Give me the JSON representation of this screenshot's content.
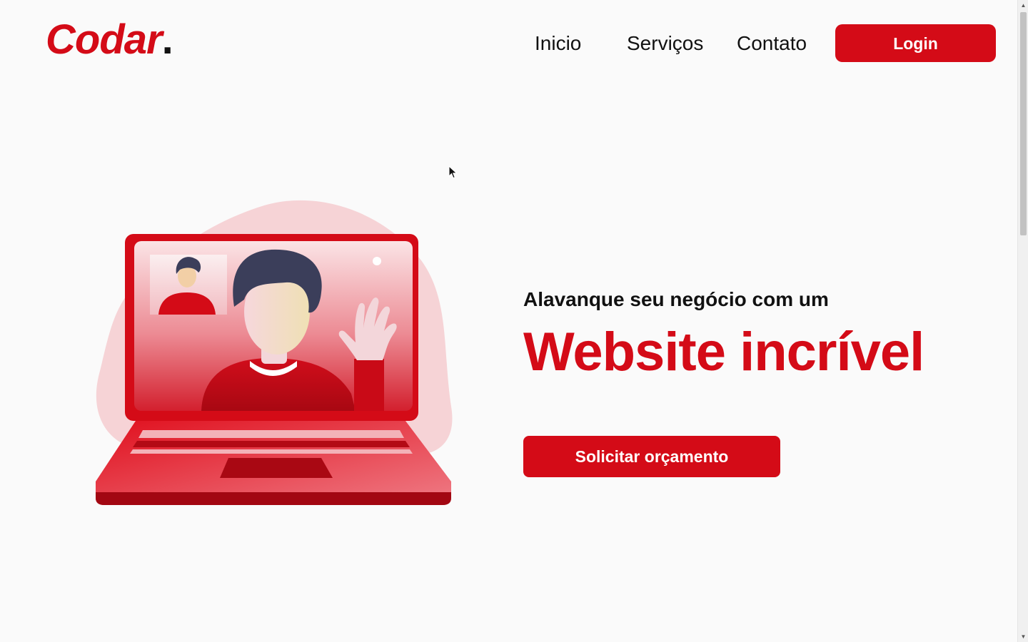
{
  "brand": {
    "name": "Codar",
    "dot": "."
  },
  "nav": {
    "items": [
      {
        "label": "Inicio"
      },
      {
        "label": "Serviços"
      },
      {
        "label": "Contato"
      }
    ],
    "login_label": "Login"
  },
  "hero": {
    "subtitle": "Alavanque seu negócio com um",
    "title": "Website incrível",
    "cta_label": "Solicitar orçamento",
    "illustration_icon": "laptop-video-call-illustration"
  },
  "colors": {
    "accent": "#d40b17",
    "text": "#111111",
    "background": "#fafafa",
    "blob": "#f6d3d6"
  },
  "scrollbar": {
    "up_icon": "▲",
    "down_icon": "▼"
  }
}
